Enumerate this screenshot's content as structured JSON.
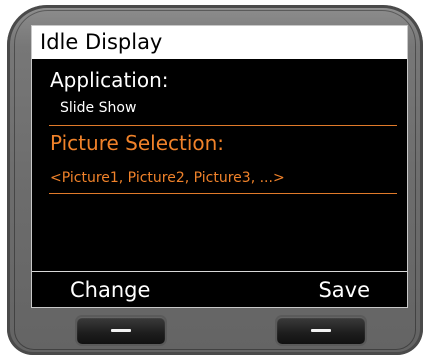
{
  "screen": {
    "title": "Idle Display",
    "application_label": "Application:",
    "application_value": "Slide Show",
    "picture_selection_label": "Picture Selection:",
    "picture_selection_value": "<Picture1, Picture2, Picture3, ...>"
  },
  "softkeys": {
    "left_label": "Change",
    "right_label": "Save"
  },
  "colors": {
    "accent": "#f0822a",
    "screen_background": "#000000",
    "title_bar_background": "#ffffff"
  },
  "icons": {
    "left_hardware_button": "softkey-dash-icon",
    "right_hardware_button": "softkey-dash-icon"
  }
}
